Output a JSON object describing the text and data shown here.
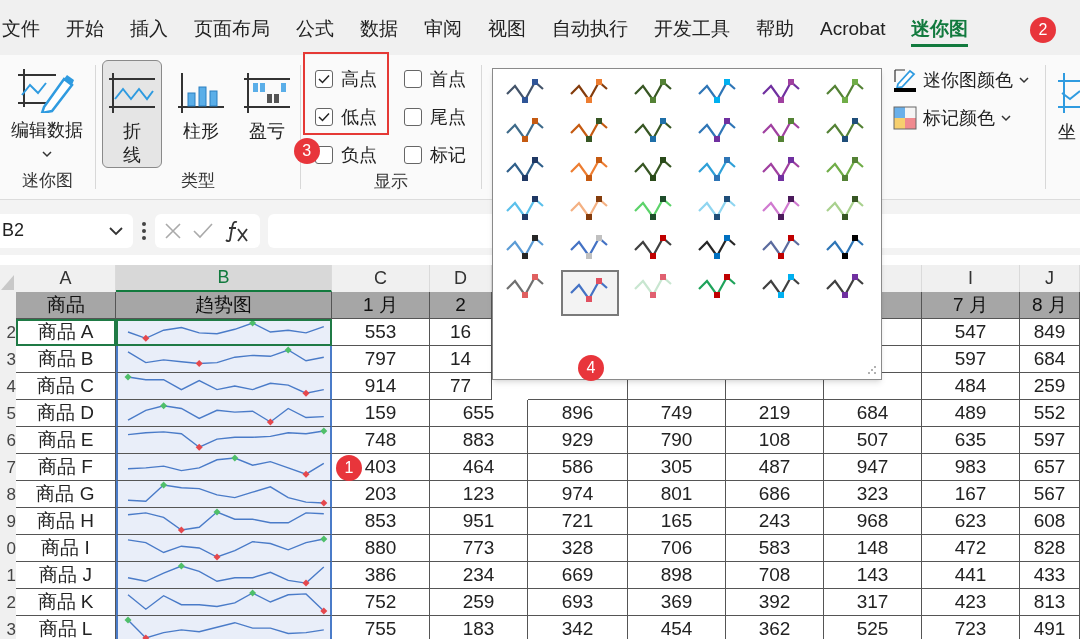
{
  "tabs": [
    {
      "label": "文件",
      "selected": false
    },
    {
      "label": "开始",
      "selected": false
    },
    {
      "label": "插入",
      "selected": false
    },
    {
      "label": "页面布局",
      "selected": false
    },
    {
      "label": "公式",
      "selected": false
    },
    {
      "label": "数据",
      "selected": false
    },
    {
      "label": "审阅",
      "selected": false
    },
    {
      "label": "视图",
      "selected": false
    },
    {
      "label": "自动执行",
      "selected": false
    },
    {
      "label": "开发工具",
      "selected": false
    },
    {
      "label": "帮助",
      "selected": false
    },
    {
      "label": "Acrobat",
      "selected": false
    },
    {
      "label": "迷你图",
      "selected": true
    }
  ],
  "tab_badge": "2",
  "sparkline_group": {
    "button": "编辑数据",
    "label": "迷你图"
  },
  "type_group": {
    "label": "类型",
    "types": [
      {
        "label": "折线",
        "kind": "line",
        "selected": true
      },
      {
        "label": "柱形",
        "kind": "column",
        "selected": false
      },
      {
        "label": "盈亏",
        "kind": "winloss",
        "selected": false
      }
    ]
  },
  "show_group": {
    "label": "显示",
    "badge": "3",
    "options": [
      {
        "label": "高点",
        "checked": true
      },
      {
        "label": "低点",
        "checked": true
      },
      {
        "label": "负点",
        "checked": false
      },
      {
        "label": "首点",
        "checked": false
      },
      {
        "label": "尾点",
        "checked": false
      },
      {
        "label": "标记",
        "checked": false
      }
    ]
  },
  "style_gallery": {
    "badge": "4",
    "styles": [
      {
        "color": "#44546a",
        "marker": {
          "color": "#2f5597"
        },
        "selected": false
      },
      {
        "color": "#843c0c",
        "marker": {
          "color": "#ed7d31"
        },
        "selected": false
      },
      {
        "color": "#375623",
        "marker": {
          "color": "#548235"
        },
        "selected": false
      },
      {
        "color": "#2e75b6",
        "marker": {
          "color": "#00b0f0"
        },
        "selected": false
      },
      {
        "color": "#7030a0",
        "marker": {
          "color": "#a040a0"
        },
        "selected": false
      },
      {
        "color": "#548235",
        "marker": {
          "color": "#70ad47"
        },
        "selected": false
      },
      {
        "color": "#3f6b8a",
        "marker": {
          "color": "#c55a11"
        },
        "selected": false
      },
      {
        "color": "#c55a11",
        "marker": {
          "color": "#375623"
        },
        "selected": false
      },
      {
        "color": "#375623",
        "marker": {
          "color": "#1f6fa8"
        },
        "selected": false
      },
      {
        "color": "#2e75b6",
        "marker": {
          "color": "#7030a0"
        },
        "selected": false
      },
      {
        "color": "#a040a0",
        "marker": {
          "color": "#548235"
        },
        "selected": false
      },
      {
        "color": "#548235",
        "marker": {
          "color": "#1f4e79"
        },
        "selected": false
      },
      {
        "color": "#2f5f8a",
        "marker": {
          "color": "#1f3864"
        },
        "selected": false
      },
      {
        "color": "#ed7d31",
        "marker": {
          "color": "#c55a11"
        },
        "selected": false
      },
      {
        "color": "#375623",
        "marker": {
          "color": "#2a4a1a"
        },
        "selected": false
      },
      {
        "color": "#2ea0d8",
        "marker": {
          "color": "#2e75b6"
        },
        "selected": false
      },
      {
        "color": "#a040a0",
        "marker": {
          "color": "#7030a0"
        },
        "selected": false
      },
      {
        "color": "#70ad47",
        "marker": {
          "color": "#548235"
        },
        "selected": false
      },
      {
        "color": "#5bc0eb",
        "marker": {
          "color": "#1f3864"
        },
        "selected": false
      },
      {
        "color": "#f4b183",
        "marker": {
          "color": "#843c0c"
        },
        "selected": false
      },
      {
        "color": "#5cd36a",
        "marker": {
          "color": "#1e4d2b"
        },
        "selected": false
      },
      {
        "color": "#8fd5f0",
        "marker": {
          "color": "#1f4e79"
        },
        "selected": false
      },
      {
        "color": "#d07ad0",
        "marker": {
          "color": "#4b1a5b"
        },
        "selected": false
      },
      {
        "color": "#a9d18e",
        "marker": {
          "color": "#375623"
        },
        "selected": false
      },
      {
        "color": "#5b9bd5",
        "marker": {
          "color": "#262626"
        },
        "selected": false
      },
      {
        "color": "#4472c4",
        "marker": {
          "color": "#c0c0c0"
        },
        "selected": false
      },
      {
        "color": "#404040",
        "marker": {
          "color": "#c00000"
        },
        "selected": false
      },
      {
        "color": "#262626",
        "marker": {
          "color": "#0070c0"
        },
        "selected": false
      },
      {
        "color": "#5b6b9e",
        "marker": {
          "color": "#c00000"
        },
        "selected": false
      },
      {
        "color": "#2e75b6",
        "marker": {
          "color": "#000000"
        },
        "selected": false
      },
      {
        "color": "#707070",
        "marker": {
          "color": "#e06060"
        },
        "selected": false
      },
      {
        "color": "#4472c4",
        "marker": {
          "color": "#e05060"
        },
        "selected": true
      },
      {
        "color": "#c8e6d0",
        "marker": {
          "color": "#e06070"
        },
        "selected": false
      },
      {
        "color": "#1fa35b",
        "marker": {
          "color": "#c00000"
        },
        "selected": false
      },
      {
        "color": "#404040",
        "marker": {
          "color": "#00b0f0"
        },
        "selected": false
      },
      {
        "color": "#404040",
        "marker": {
          "color": "#7030a0"
        },
        "selected": false
      }
    ]
  },
  "color_menus": [
    {
      "label": "迷你图颜色",
      "kind": "line"
    },
    {
      "label": "标记颜色",
      "kind": "marker"
    }
  ],
  "axis_button": {
    "label": "坐"
  },
  "formula_bar": {
    "name_box": "B2"
  },
  "columns": [
    {
      "label": "A",
      "selected": false
    },
    {
      "label": "B",
      "selected": true
    },
    {
      "label": "C",
      "selected": false
    },
    {
      "label": "D",
      "selected": false
    },
    {
      "label": "I",
      "selected": false
    },
    {
      "label": "J",
      "selected": false
    }
  ],
  "header": [
    "商品",
    "趋势图",
    "1 月",
    "2",
    "7 月",
    "8 月"
  ],
  "rows": [
    {
      "number": "2",
      "active": true,
      "cells": [
        "商品 A",
        "553",
        "16",
        "547",
        "849"
      ]
    },
    {
      "number": "3",
      "active": false,
      "cells": [
        "商品 B",
        "797",
        "14",
        "597",
        "684"
      ]
    },
    {
      "number": "4",
      "active": false,
      "cells": [
        "商品 C",
        "914",
        "77",
        "484",
        "259"
      ]
    },
    {
      "number": "5",
      "active": false,
      "cells": [
        "商品 D",
        "159",
        "655",
        "896",
        "749",
        "219",
        "684",
        "489",
        "552"
      ]
    },
    {
      "number": "6",
      "active": false,
      "cells": [
        "商品 E",
        "748",
        "883",
        "929",
        "790",
        "108",
        "507",
        "635",
        "597"
      ]
    },
    {
      "number": "7",
      "active": false,
      "cells": [
        "商品 F",
        "403",
        "464",
        "586",
        "305",
        "487",
        "947",
        "983",
        "657"
      ]
    },
    {
      "number": "8",
      "active": false,
      "cells": [
        "商品 G",
        "203",
        "123",
        "974",
        "801",
        "686",
        "323",
        "167",
        "567"
      ]
    },
    {
      "number": "9",
      "active": false,
      "cells": [
        "商品 H",
        "853",
        "951",
        "721",
        "165",
        "243",
        "968",
        "623",
        "608"
      ]
    },
    {
      "number": "0",
      "active": false,
      "cells": [
        "商品 I",
        "880",
        "773",
        "328",
        "706",
        "583",
        "148",
        "472",
        "828"
      ]
    },
    {
      "number": "1",
      "active": false,
      "cells": [
        "商品 J",
        "386",
        "234",
        "669",
        "898",
        "708",
        "143",
        "441",
        "433"
      ]
    },
    {
      "number": "2",
      "active": false,
      "cells": [
        "商品 K",
        "752",
        "259",
        "693",
        "369",
        "392",
        "317",
        "423",
        "813"
      ]
    },
    {
      "number": "3",
      "active": false,
      "cells": [
        "商品 L",
        "755",
        "183",
        "342",
        "454",
        "362",
        "525",
        "723",
        "491"
      ]
    }
  ],
  "sheet_badge": "1"
}
